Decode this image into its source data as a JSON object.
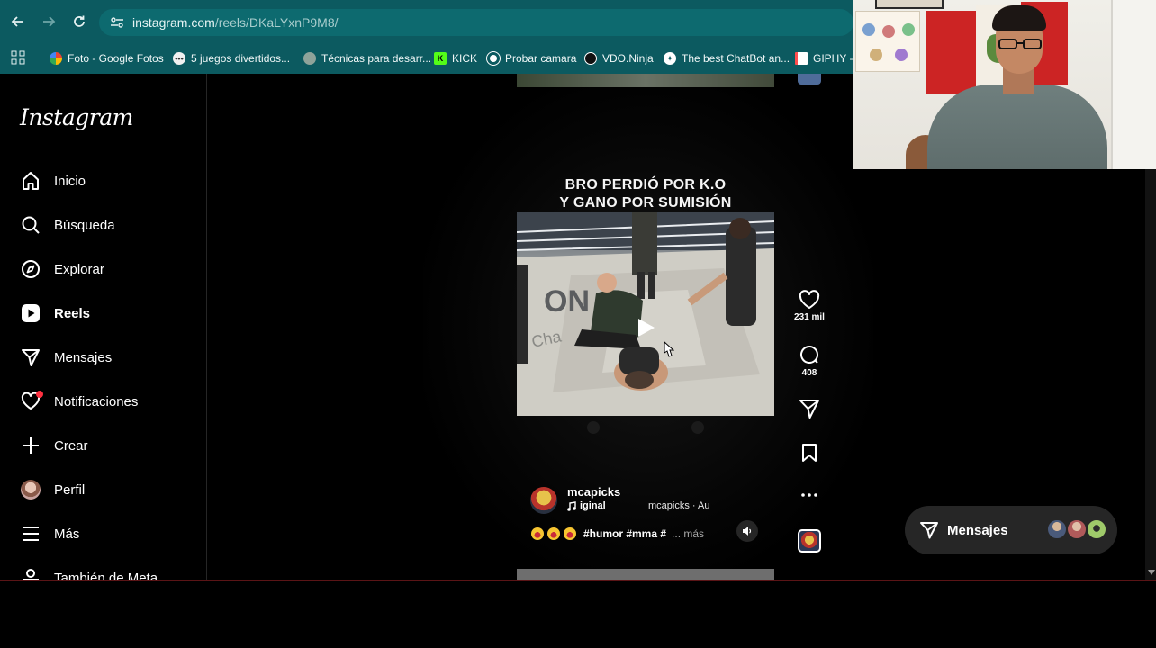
{
  "browser": {
    "url_domain": "instagram.com",
    "url_path": "/reels/DKaLYxnP9M8/",
    "bookmarks": [
      {
        "label": "Foto - Google Fotos",
        "icon": "google-photos-icon",
        "color": "#f4b400"
      },
      {
        "label": "5 juegos divertidos...",
        "icon": "site-icon",
        "color": "#f1f1f1"
      },
      {
        "label": "Técnicas para desarr...",
        "icon": "site-icon",
        "color": "#6fbf73"
      },
      {
        "label": "KICK",
        "icon": "kick-icon",
        "color": "#53fc18"
      },
      {
        "label": "Probar camara",
        "icon": "site-icon",
        "color": "#ffffff"
      },
      {
        "label": "VDO.Ninja",
        "icon": "vdo-ninja-icon",
        "color": "#ffffff"
      },
      {
        "label": "The best ChatBot an...",
        "icon": "chatbot-icon",
        "color": "#ffffff"
      },
      {
        "label": "GIPHY - S",
        "icon": "giphy-icon",
        "color": "#ff4e4e"
      }
    ]
  },
  "sidebar": {
    "logo": "Instagram",
    "items": [
      {
        "label": "Inicio",
        "icon": "home-icon"
      },
      {
        "label": "Búsqueda",
        "icon": "search-icon"
      },
      {
        "label": "Explorar",
        "icon": "compass-icon"
      },
      {
        "label": "Reels",
        "icon": "reels-icon"
      },
      {
        "label": "Mensajes",
        "icon": "send-icon"
      },
      {
        "label": "Notificaciones",
        "icon": "heart-icon"
      },
      {
        "label": "Crear",
        "icon": "plus-icon"
      },
      {
        "label": "Perfil",
        "icon": "avatar"
      },
      {
        "label": "Más",
        "icon": "menu-icon"
      },
      {
        "label": "También de Meta",
        "icon": "meta-apps-icon"
      }
    ]
  },
  "reel": {
    "caption_line1": "BRO PERDIÓ POR K.O",
    "caption_line2": "Y GANO POR SUMISIÓN",
    "author": "mcapicks",
    "audio": "iginal",
    "audio_credit": "mcapicks · Au",
    "hashtags": "#humor #mma #",
    "more": "... más",
    "likes": "231 mil",
    "comments": "408"
  },
  "messages": {
    "label": "Mensajes"
  },
  "colors": {
    "chrome": "#0c5a60",
    "background": "#000000",
    "pill": "#262626",
    "notification_dot": "#ff3040"
  }
}
